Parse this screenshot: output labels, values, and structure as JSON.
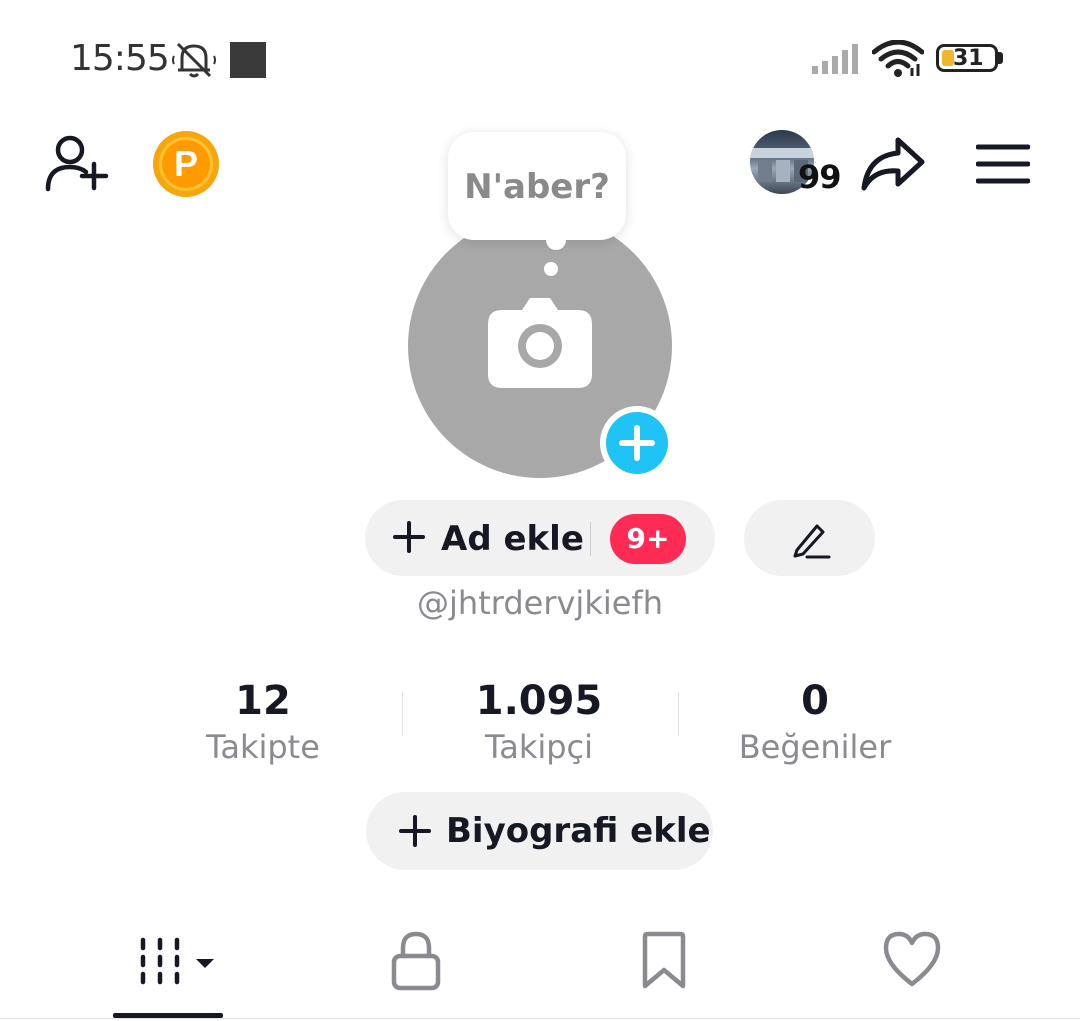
{
  "status_bar": {
    "time": "15:55",
    "battery": "31"
  },
  "top_bar": {
    "avatar_count": "99"
  },
  "profile": {
    "bubble_text": "N'aber?",
    "add_name_label": "Ad ekle",
    "notification_badge": "9+",
    "username": "@jhtrdervjkiefh"
  },
  "stats": [
    {
      "value": "12",
      "label": "Takipte"
    },
    {
      "value": "1.095",
      "label": "Takipçi"
    },
    {
      "value": "0",
      "label": "Beğeniler"
    }
  ],
  "bio": {
    "add_bio_label": "Biyografi ekle"
  },
  "tabs": [
    {
      "icon": "grid-icon"
    },
    {
      "icon": "lock-icon"
    },
    {
      "icon": "bookmark-icon"
    },
    {
      "icon": "heart-icon"
    }
  ],
  "colors": {
    "accent_blue": "#20c3f5",
    "badge_red": "#fe2c55",
    "coin_orange": "#ff9b00"
  }
}
